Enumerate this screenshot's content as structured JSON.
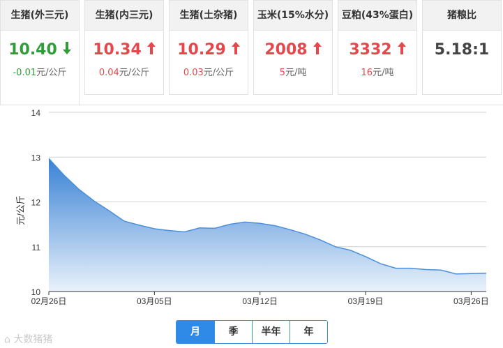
{
  "cards": [
    {
      "title": "生猪(外三元)",
      "price": "10.40",
      "dir": "down",
      "change": "-0.01",
      "unit": "元/公斤"
    },
    {
      "title": "生猪(内三元)",
      "price": "10.34",
      "dir": "up",
      "change": "0.04",
      "unit": "元/公斤"
    },
    {
      "title": "生猪(土杂猪)",
      "price": "10.29",
      "dir": "up",
      "change": "0.03",
      "unit": "元/公斤"
    },
    {
      "title": "玉米(15%水分)",
      "price": "2008",
      "dir": "up",
      "change": "5",
      "unit": "元/吨"
    },
    {
      "title": "豆粕(43%蛋白)",
      "price": "3332",
      "dir": "up",
      "change": "16",
      "unit": "元/吨"
    },
    {
      "title": "猪粮比",
      "price": "5.18:1",
      "dir": "none",
      "change": "",
      "unit": ""
    }
  ],
  "chart_data": {
    "type": "area",
    "ylabel": "元/公斤",
    "ylim": [
      10,
      14
    ],
    "yticks": [
      10,
      11,
      12,
      13,
      14
    ],
    "xticklabels": [
      "02月26日",
      "03月05日",
      "03月12日",
      "03月19日",
      "03月26日"
    ],
    "x": [
      "02-26",
      "02-27",
      "02-28",
      "03-01",
      "03-02",
      "03-03",
      "03-04",
      "03-05",
      "03-06",
      "03-07",
      "03-08",
      "03-09",
      "03-10",
      "03-11",
      "03-12",
      "03-13",
      "03-14",
      "03-15",
      "03-16",
      "03-17",
      "03-18",
      "03-19",
      "03-20",
      "03-21",
      "03-22",
      "03-23",
      "03-24",
      "03-25",
      "03-26",
      "03-27"
    ],
    "values": [
      12.97,
      12.6,
      12.28,
      12.02,
      11.8,
      11.57,
      11.48,
      11.4,
      11.36,
      11.33,
      11.42,
      11.41,
      11.5,
      11.55,
      11.52,
      11.47,
      11.38,
      11.28,
      11.15,
      11.0,
      10.92,
      10.78,
      10.62,
      10.52,
      10.52,
      10.49,
      10.48,
      10.39,
      10.4,
      10.41
    ],
    "color": "#3f86d6",
    "grid": true
  },
  "tabs": [
    {
      "label": "月",
      "selected": true
    },
    {
      "label": "季",
      "selected": false
    },
    {
      "label": "半年",
      "selected": false
    },
    {
      "label": "年",
      "selected": false
    }
  ],
  "watermark": "大数猪猪"
}
